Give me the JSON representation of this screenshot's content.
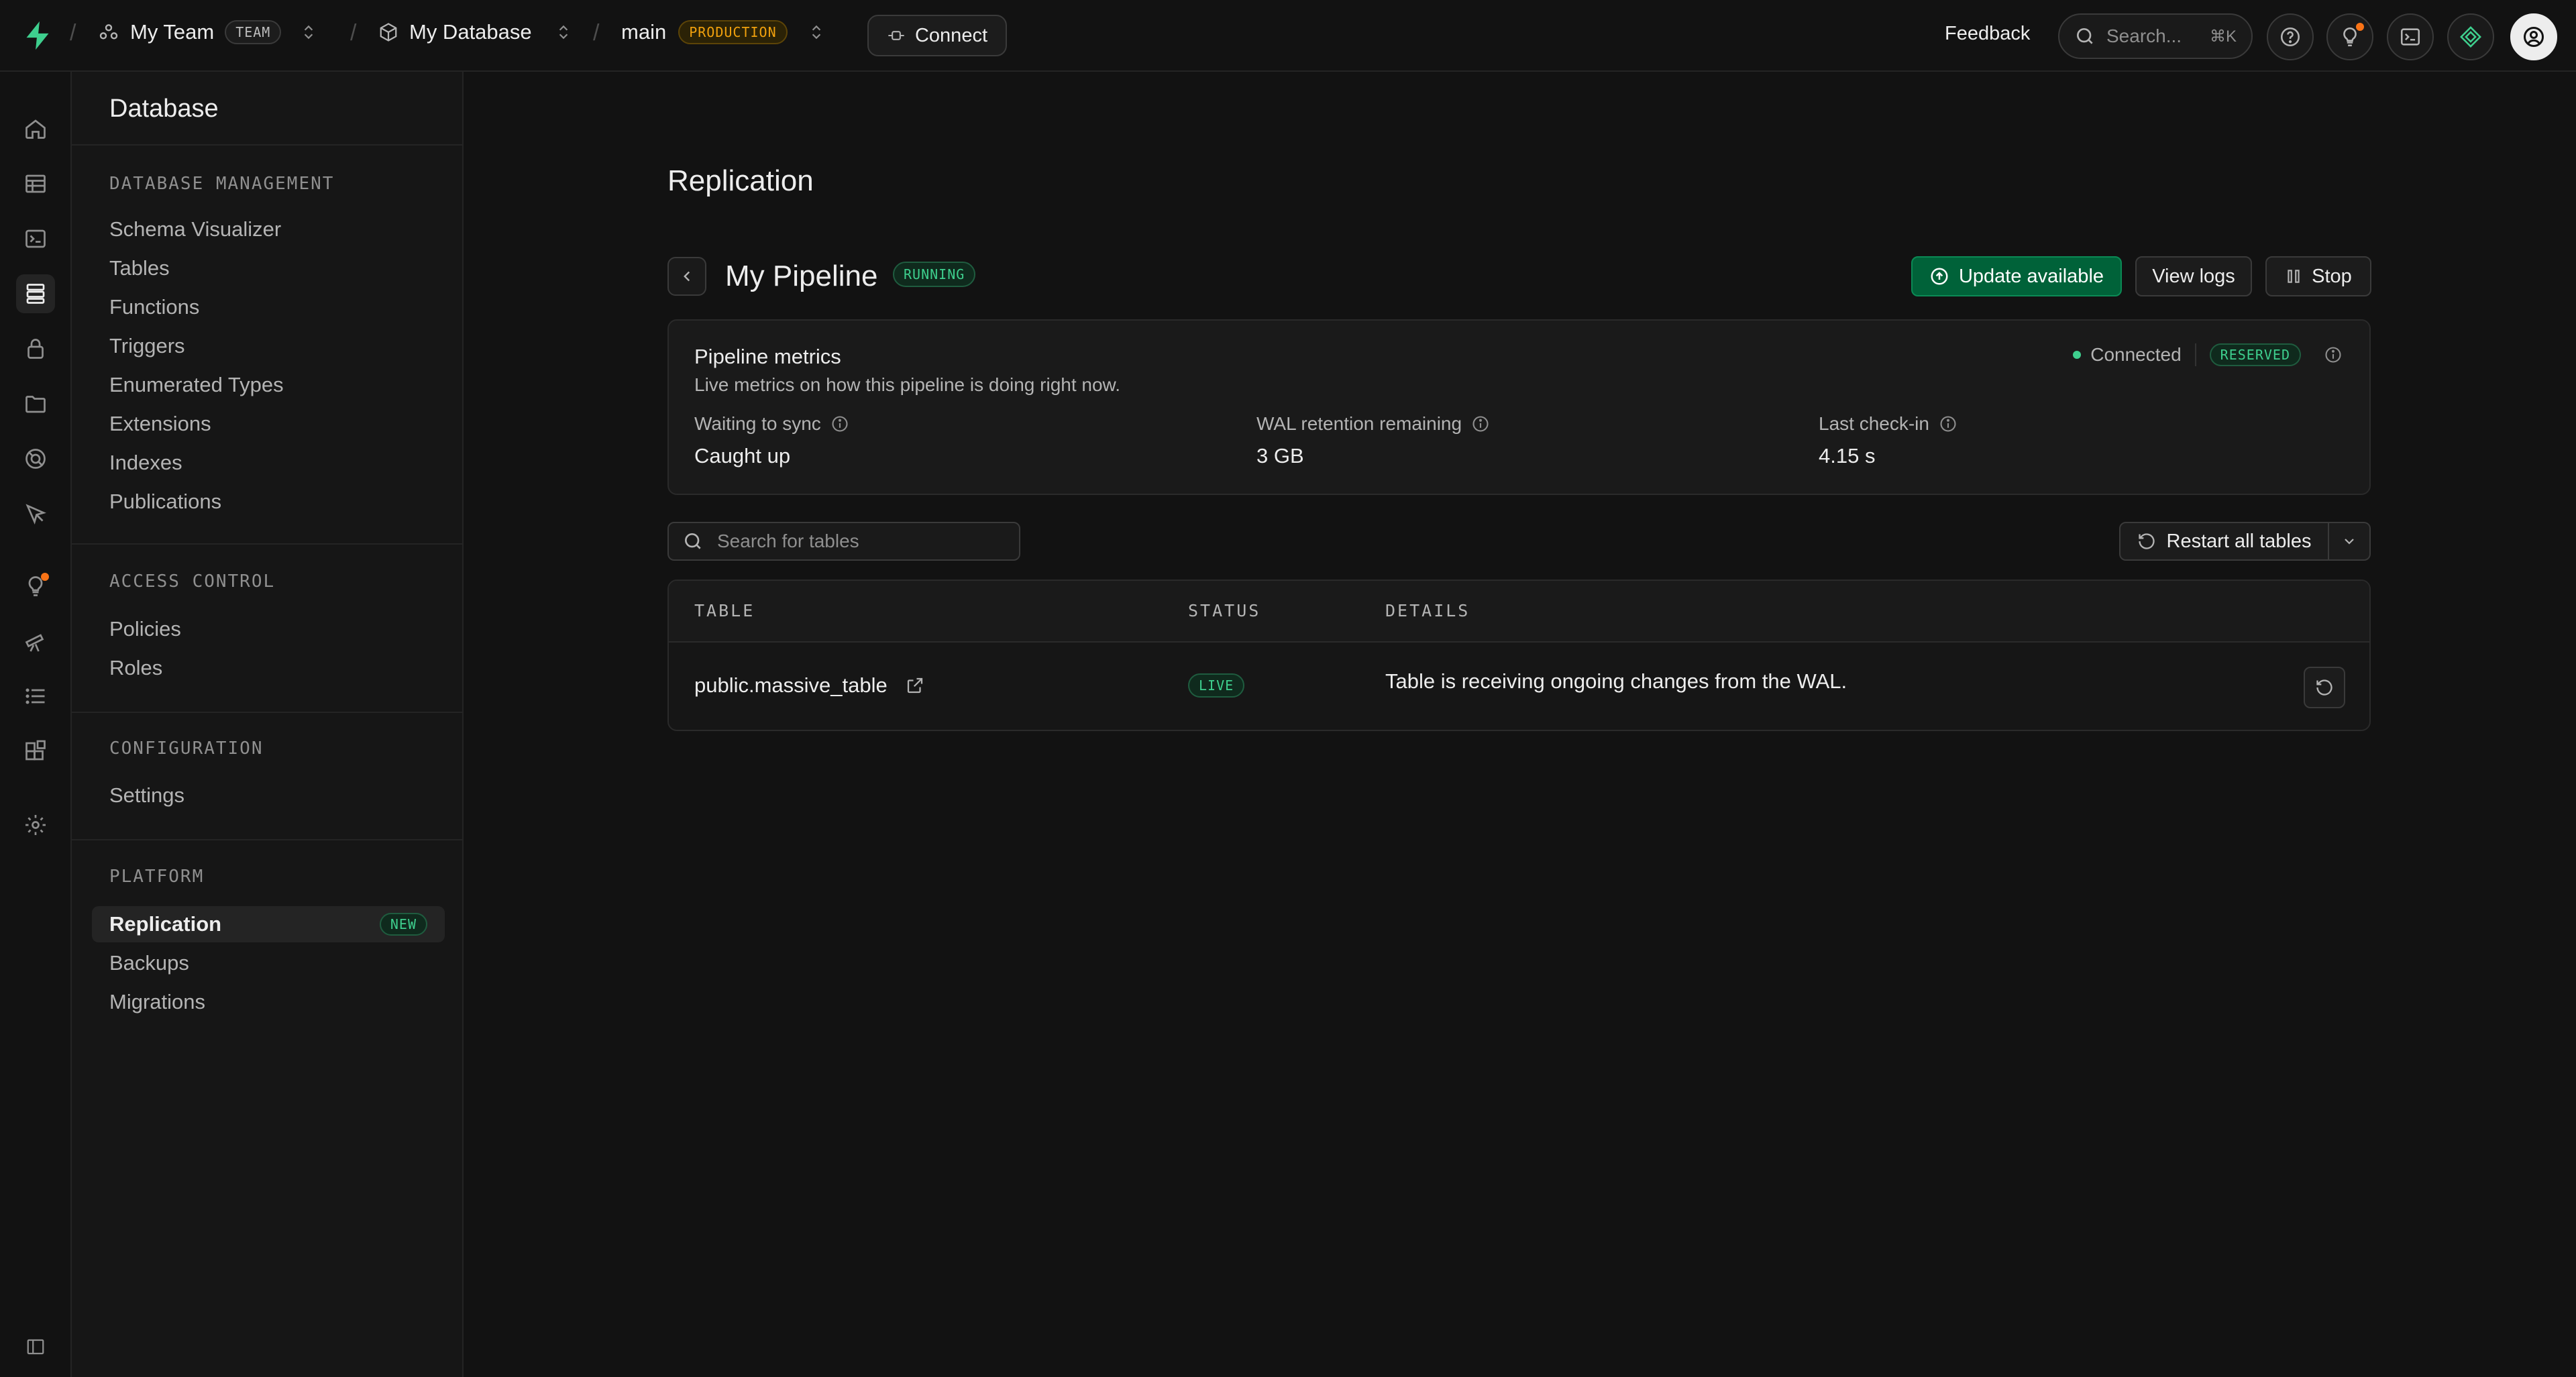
{
  "header": {
    "team_name": "My Team",
    "team_badge": "TEAM",
    "database_name": "My Database",
    "branch_name": "main",
    "branch_badge": "PRODUCTION",
    "connect_label": "Connect",
    "feedback_label": "Feedback",
    "search_placeholder": "Search...",
    "search_shortcut": "⌘K"
  },
  "sidebar": {
    "title": "Database",
    "sections": [
      {
        "label": "DATABASE MANAGEMENT",
        "items": [
          "Schema Visualizer",
          "Tables",
          "Functions",
          "Triggers",
          "Enumerated Types",
          "Extensions",
          "Indexes",
          "Publications"
        ]
      },
      {
        "label": "ACCESS CONTROL",
        "items": [
          "Policies",
          "Roles"
        ]
      },
      {
        "label": "CONFIGURATION",
        "items": [
          "Settings"
        ]
      },
      {
        "label": "PLATFORM",
        "items": [
          "Replication",
          "Backups",
          "Migrations"
        ],
        "active": "Replication",
        "active_badge": "NEW"
      }
    ]
  },
  "main": {
    "page_title": "Replication",
    "pipeline_name": "My Pipeline",
    "pipeline_status": "RUNNING",
    "actions": {
      "update_label": "Update available",
      "logs_label": "View logs",
      "stop_label": "Stop"
    },
    "metrics": {
      "title": "Pipeline metrics",
      "subtitle": "Live metrics on how this pipeline is doing right now.",
      "connection_status": "Connected",
      "reserved_badge": "RESERVED",
      "items": [
        {
          "label": "Waiting to sync",
          "value": "Caught up"
        },
        {
          "label": "WAL retention remaining",
          "value": "3 GB"
        },
        {
          "label": "Last check-in",
          "value": "4.15 s"
        }
      ]
    },
    "table_search_placeholder": "Search for tables",
    "restart_all_label": "Restart all tables",
    "table": {
      "columns": [
        "TABLE",
        "STATUS",
        "DETAILS"
      ],
      "rows": [
        {
          "table": "public.massive_table",
          "status": "LIVE",
          "details": "Table is receiving ongoing changes from the WAL."
        }
      ]
    }
  },
  "colors": {
    "background": "#121212",
    "brand_green": "#3ecf8e",
    "button_green": "#006239",
    "production_amber": "#f1a10d",
    "notification_dot": "#f97316"
  }
}
